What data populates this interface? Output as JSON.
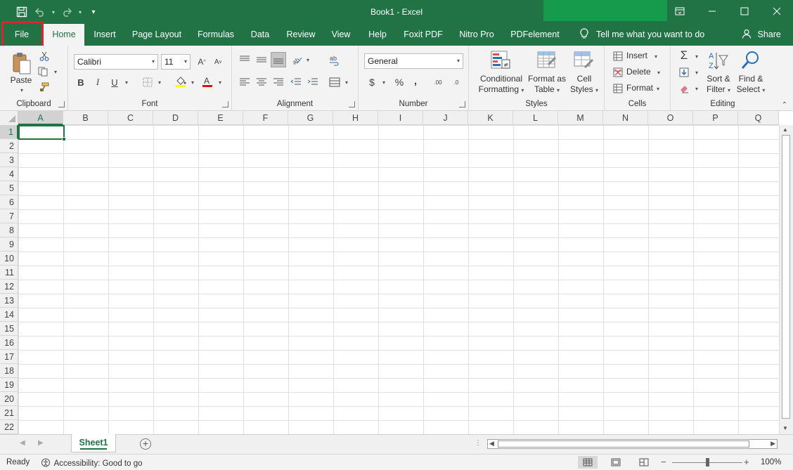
{
  "window": {
    "title": "Book1  -  Excel",
    "qat": {
      "save": "save-icon",
      "undo": "undo-icon",
      "redo": "redo-icon",
      "customize": "▾"
    },
    "controls": {
      "ribbon_display": "▭",
      "minimize": "—",
      "maximize": "☐",
      "close": "✕"
    }
  },
  "tabs": {
    "file": "File",
    "home": "Home",
    "insert": "Insert",
    "page_layout": "Page Layout",
    "formulas": "Formulas",
    "data": "Data",
    "review": "Review",
    "view": "View",
    "help": "Help",
    "foxit": "Foxit PDF",
    "nitro": "Nitro Pro",
    "pdfelement": "PDFelement",
    "tell_me": "Tell me what you want to do",
    "share": "Share"
  },
  "ribbon": {
    "clipboard": {
      "label": "Clipboard",
      "paste": "Paste"
    },
    "font": {
      "label": "Font",
      "font_name": "Calibri",
      "font_size": "11",
      "bold": "B",
      "italic": "I",
      "underline": "U"
    },
    "alignment": {
      "label": "Alignment"
    },
    "number": {
      "label": "Number",
      "format": "General",
      "currency": "$",
      "percent": "%",
      "comma": ",",
      "inc_dec": ".00",
      "dec_dec": ".0"
    },
    "styles": {
      "label": "Styles",
      "conditional_1": "Conditional",
      "conditional_2": "Formatting",
      "format_table_1": "Format as",
      "format_table_2": "Table",
      "cell_styles_1": "Cell",
      "cell_styles_2": "Styles"
    },
    "cells": {
      "label": "Cells",
      "insert": "Insert",
      "delete": "Delete",
      "format": "Format"
    },
    "editing": {
      "label": "Editing",
      "sort_1": "Sort &",
      "sort_2": "Filter",
      "find_1": "Find &",
      "find_2": "Select"
    }
  },
  "sheet": {
    "columns": [
      "A",
      "B",
      "C",
      "D",
      "E",
      "F",
      "G",
      "H",
      "I",
      "J",
      "K",
      "L",
      "M",
      "N",
      "O",
      "P",
      "Q"
    ],
    "rows": [
      "1",
      "2",
      "3",
      "4",
      "5",
      "6",
      "7",
      "8",
      "9",
      "10",
      "11",
      "12",
      "13",
      "14",
      "15",
      "16",
      "17",
      "18",
      "19",
      "20",
      "21",
      "22"
    ],
    "active_cell": "A1"
  },
  "sheet_tabs": {
    "active": "Sheet1"
  },
  "status": {
    "ready": "Ready",
    "accessibility": "Accessibility: Good to go",
    "zoom": "100%",
    "zoom_level": 100
  }
}
